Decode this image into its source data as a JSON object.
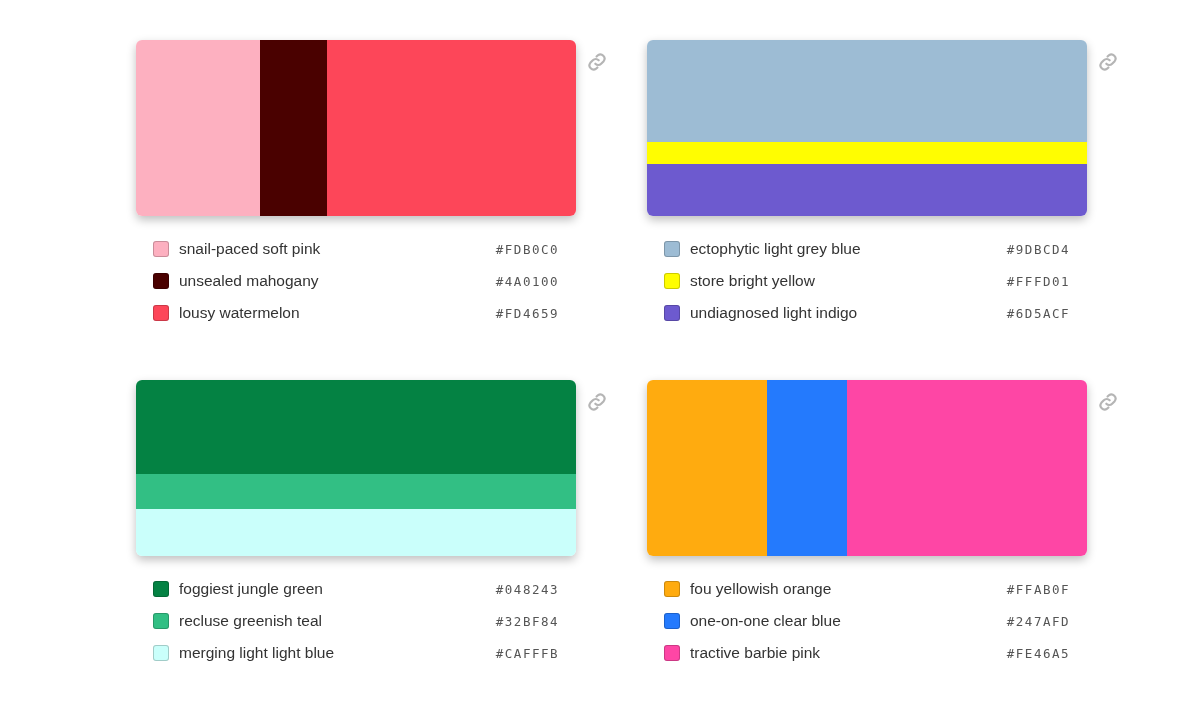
{
  "palettes": [
    {
      "kind": "columns",
      "colors": [
        {
          "name": "snail-paced soft pink",
          "hex": "#FDB0C0",
          "color": "#fdb0c0"
        },
        {
          "name": "unsealed mahogany",
          "hex": "#4A0100",
          "color": "#4a0100"
        },
        {
          "name": "lousy watermelon",
          "hex": "#FD4659",
          "color": "#fd4659"
        }
      ]
    },
    {
      "kind": "rows",
      "colors": [
        {
          "name": "ectophytic light grey blue",
          "hex": "#9DBCD4",
          "color": "#9dbcd4"
        },
        {
          "name": "store bright yellow",
          "hex": "#FFFD01",
          "color": "#fffd01"
        },
        {
          "name": "undiagnosed light indigo",
          "hex": "#6D5ACF",
          "color": "#6d5acf"
        }
      ]
    },
    {
      "kind": "rows",
      "colors": [
        {
          "name": "foggiest jungle green",
          "hex": "#048243",
          "color": "#048243"
        },
        {
          "name": "recluse greenish teal",
          "hex": "#32BF84",
          "color": "#32bf84"
        },
        {
          "name": "merging light light blue",
          "hex": "#CAFFFB",
          "color": "#cafffb"
        }
      ]
    },
    {
      "kind": "columns",
      "colors": [
        {
          "name": "fou yellowish orange",
          "hex": "#FFAB0F",
          "color": "#ffab0f"
        },
        {
          "name": "one-on-one clear blue",
          "hex": "#247AFD",
          "color": "#247afd"
        },
        {
          "name": "tractive barbie pink",
          "hex": "#FE46A5",
          "color": "#fe46a5"
        }
      ]
    }
  ]
}
